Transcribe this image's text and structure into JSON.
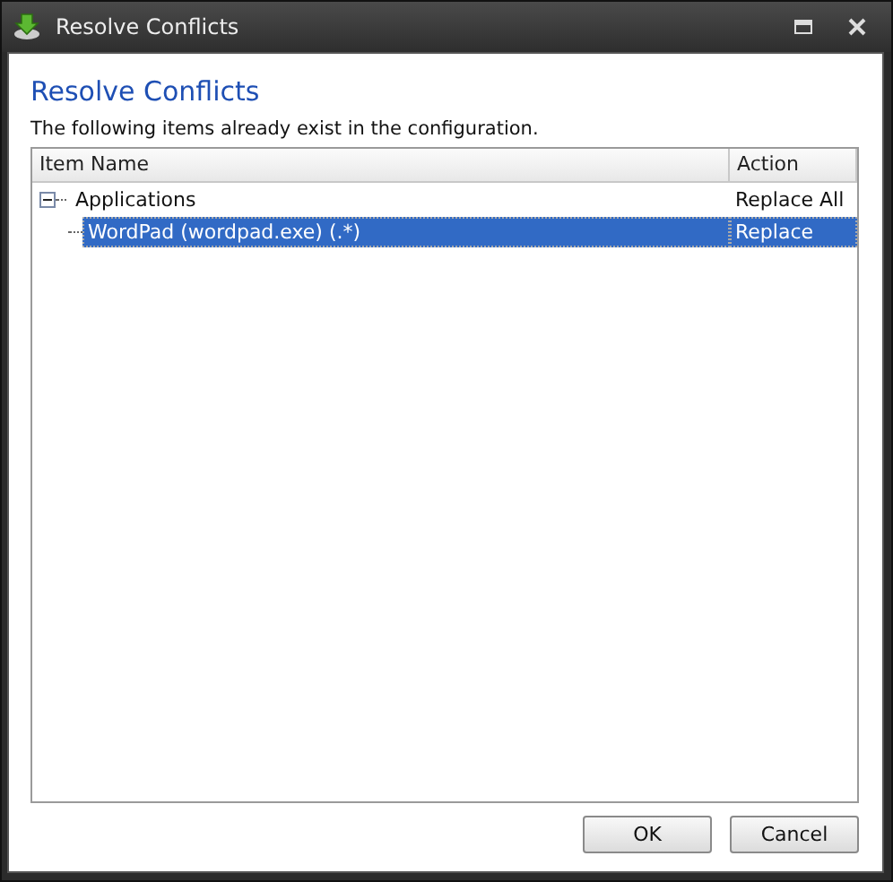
{
  "window": {
    "title": "Resolve Conflicts"
  },
  "heading": "Resolve Conflicts",
  "description": "The following items already exist in the configuration.",
  "table": {
    "columns": [
      "Item Name",
      "Action"
    ],
    "rows": [
      {
        "name": "Applications",
        "action": "Replace All",
        "expanded": true,
        "selected": false,
        "children": [
          {
            "name": "WordPad (wordpad.exe) (.*)",
            "action": "Replace",
            "selected": true
          }
        ]
      }
    ]
  },
  "buttons": [
    "OK",
    "Cancel"
  ]
}
